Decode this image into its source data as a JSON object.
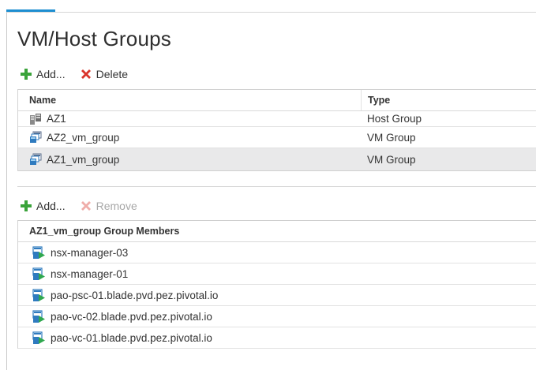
{
  "title": "VM/Host Groups",
  "groups_toolbar": {
    "add_label": "Add...",
    "delete_label": "Delete"
  },
  "groups_table": {
    "columns": [
      "Name",
      "Type"
    ],
    "rows": [
      {
        "name": "AZ1",
        "type": "Host Group",
        "icon": "host-group-icon"
      },
      {
        "name": "AZ2_vm_group",
        "type": "VM Group",
        "icon": "vm-group-icon"
      },
      {
        "name": "AZ1_vm_group",
        "type": "VM Group",
        "icon": "vm-group-icon"
      }
    ],
    "selected_row": "AZ1_vm_group"
  },
  "members_toolbar": {
    "add_label": "Add...",
    "remove_label": "Remove"
  },
  "members_table": {
    "header": "AZ1_vm_group Group Members",
    "rows": [
      "nsx-manager-03",
      "nsx-manager-01",
      "pao-psc-01.blade.pvd.pez.pivotal.io",
      "pao-vc-02.blade.pvd.pez.pivotal.io",
      "pao-vc-01.blade.pvd.pez.pivotal.io"
    ],
    "row_icon": "vm-powered-on-icon"
  },
  "colors": {
    "accent": "#1d8ed1",
    "add_green": "#3aa33a",
    "delete_red": "#d9342b",
    "selected_row": "#e9e9ea"
  }
}
